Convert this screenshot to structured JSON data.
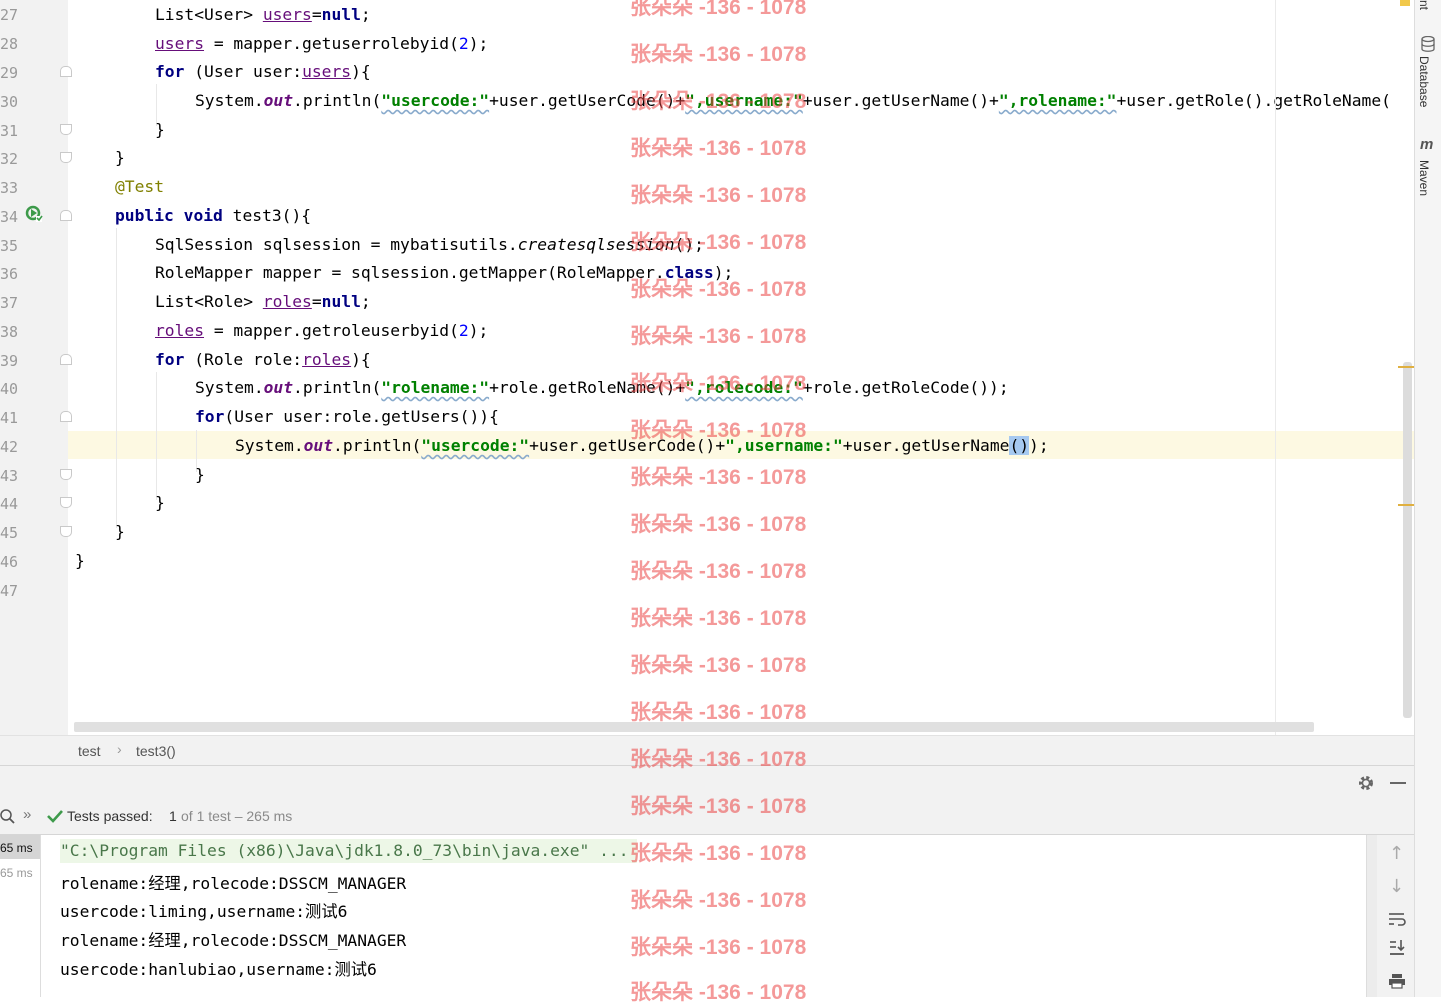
{
  "editor": {
    "line_numbers": [
      "27",
      "28",
      "29",
      "30",
      "31",
      "32",
      "33",
      "34",
      "35",
      "36",
      "37",
      "38",
      "39",
      "40",
      "41",
      "42",
      "43",
      "44",
      "45",
      "46",
      "47"
    ],
    "lines": {
      "l27": {
        "a": "List<User> ",
        "b": "users",
        "c": "=",
        "d": "null",
        ";": ";"
      },
      "l28": {
        "a": "users",
        "b": " = mapper.getuserrolebyid(",
        "n": "2",
        "c": ");"
      },
      "l29": {
        "kw": "for",
        "a": " (User user:",
        "b": "users",
        "c": "){"
      },
      "l30": {
        "a": "System.",
        "out": "out",
        "b": ".println(",
        "s1": "\"usercode:\"",
        "c": "+user.getUserCode()+",
        "s2": "\",username:\"",
        "d": "+user.getUserName()+",
        "s3": "\",rolename:\"",
        "e": "+user.getRole().getRoleName("
      },
      "l31": {
        "a": "}"
      },
      "l32": {
        "a": "}"
      },
      "l33": {
        "a": "@Test"
      },
      "l34": {
        "kw1": "public",
        "kw2": "void",
        "a": " test3(){"
      },
      "l35": {
        "a": "SqlSession sqlsession = mybatisutils.",
        "b": "createsqlsession",
        "c": "();"
      },
      "l36": {
        "a": "RoleMapper mapper = sqlsession.getMapper(RoleMapper.",
        "kw": "class",
        "c": ");"
      },
      "l37": {
        "a": "List<Role> ",
        "b": "roles",
        "c": "=",
        "d": "null",
        ";": ";"
      },
      "l38": {
        "a": "roles",
        "b": " = mapper.getroleuserbyid(",
        "n": "2",
        "c": ");"
      },
      "l39": {
        "kw": "for",
        "a": " (Role role:",
        "b": "roles",
        "c": "){"
      },
      "l40": {
        "a": "System.",
        "out": "out",
        "b": ".println(",
        "s1": "\"rolename:\"",
        "c": "+role.getRoleName()+",
        "s2": "\",rolecode:\"",
        "d": "+role.getRoleCode());"
      },
      "l41": {
        "kw": "for",
        "a": "(User user:role.getUsers()){"
      },
      "l42": {
        "a": "System.",
        "out": "out",
        "b": ".println(",
        "s1": "\"usercode:\"",
        "c": "+user.getUserCode()+",
        "s2": "\",username:\"",
        "d": "+user.getUserName",
        "sel": "()",
        "e": ");"
      },
      "l43": {
        "a": "}"
      },
      "l44": {
        "a": "}"
      },
      "l45": {
        "a": "}"
      },
      "l46": {
        "a": "}"
      }
    }
  },
  "tool_window_labels": {
    "database": "Database",
    "maven": "Maven",
    "truncated": "nt"
  },
  "breadcrumb": {
    "class": "test",
    "separator": "›",
    "method": "test3()"
  },
  "run": {
    "status_label": "Tests passed:",
    "passed": "1",
    "of_text": "of 1 test – 265 ms",
    "tree_times": [
      "65 ms",
      "65 ms"
    ]
  },
  "console": {
    "lines": [
      "\"C:\\Program Files (x86)\\Java\\jdk1.8.0_73\\bin\\java.exe\" ...",
      "rolename:经理,rolecode:DSSCM_MANAGER",
      "usercode:liming,username:测试6",
      "rolename:经理,rolecode:DSSCM_MANAGER",
      "usercode:hanlubiao,username:测试6"
    ]
  },
  "watermark": {
    "text": "张朵朵 -136 - 1078",
    "color": "#eb4646"
  },
  "colors": {
    "keyword": "#000080",
    "string": "#008000",
    "number": "#0000ff",
    "annotation": "#808000",
    "field": "#660e7a",
    "caret_line": "#fdf9e2"
  }
}
